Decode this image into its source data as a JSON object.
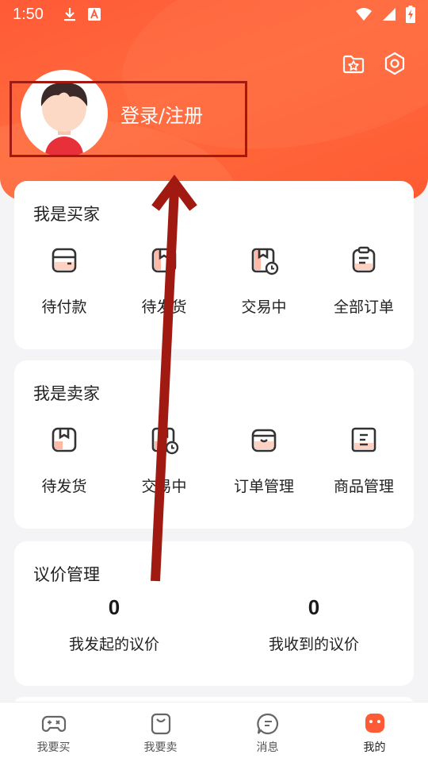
{
  "status_bar": {
    "time": "1:50"
  },
  "profile": {
    "login_label": "登录/注册"
  },
  "buyer": {
    "title": "我是买家",
    "items": [
      {
        "label": "待付款",
        "icon": "wallet-icon"
      },
      {
        "label": "待发货",
        "icon": "package-icon"
      },
      {
        "label": "交易中",
        "icon": "package-clock-icon"
      },
      {
        "label": "全部订单",
        "icon": "clipboard-icon"
      }
    ]
  },
  "seller": {
    "title": "我是卖家",
    "items": [
      {
        "label": "待发货",
        "icon": "package-icon"
      },
      {
        "label": "交易中",
        "icon": "package-clock-icon"
      },
      {
        "label": "订单管理",
        "icon": "box-icon"
      },
      {
        "label": "商品管理",
        "icon": "list-doc-icon"
      }
    ]
  },
  "negotiation": {
    "title": "议价管理",
    "initiated": {
      "count": "0",
      "label": "我发起的议价"
    },
    "received": {
      "count": "0",
      "label": "我收到的议价"
    }
  },
  "tabs": [
    {
      "label": "我要买",
      "icon": "gamepad-icon"
    },
    {
      "label": "我要卖",
      "icon": "bag-icon"
    },
    {
      "label": "消息",
      "icon": "chat-icon"
    },
    {
      "label": "我的",
      "icon": "profile-icon",
      "active": true
    }
  ],
  "colors": {
    "accent": "#ff5a36",
    "annotation": "#a01a12"
  }
}
